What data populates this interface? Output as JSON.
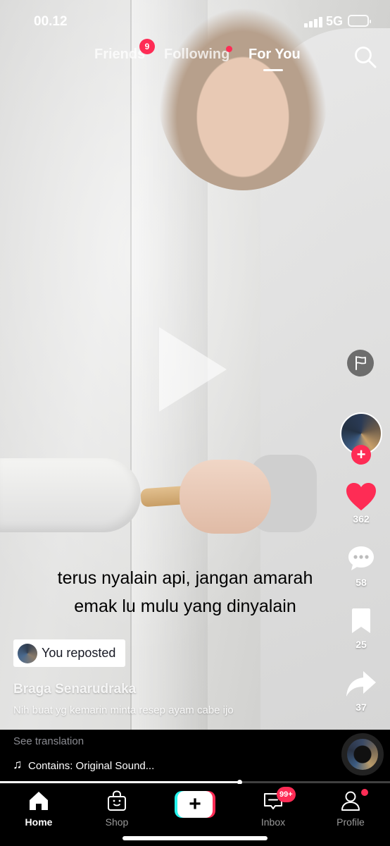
{
  "status_bar": {
    "time": "00.12",
    "network": "5G"
  },
  "top_tabs": {
    "friends": "Friends",
    "friends_badge": "9",
    "following": "Following",
    "for_you": "For You",
    "active": "For You"
  },
  "video": {
    "subtitle_line1": "terus nyalain api, jangan amarah",
    "subtitle_line2": "emak lu mulu yang dinyalain",
    "reposted_label": "You reposted",
    "author": "Braga Senarudraka",
    "description": "Nih buat yg kemarin minta resep ayam cabe ijo"
  },
  "actions": {
    "likes": "362",
    "comments": "58",
    "saves": "25",
    "shares": "37"
  },
  "info_strip": {
    "see_translation": "See translation",
    "sound": "Contains: Original Sound..."
  },
  "progress": {
    "fraction": 0.615
  },
  "bottom_nav": {
    "home": "Home",
    "shop": "Shop",
    "create": "+",
    "inbox": "Inbox",
    "inbox_badge": "99+",
    "profile": "Profile"
  },
  "colors": {
    "accent": "#fe2c55",
    "cyan": "#25f4ee",
    "battery": "#f2c94c"
  },
  "icons": [
    "search-icon",
    "flag-icon",
    "heart-icon",
    "comment-icon",
    "bookmark-icon",
    "share-icon",
    "music-note-icon",
    "home-icon",
    "shop-icon",
    "inbox-icon",
    "profile-icon"
  ]
}
